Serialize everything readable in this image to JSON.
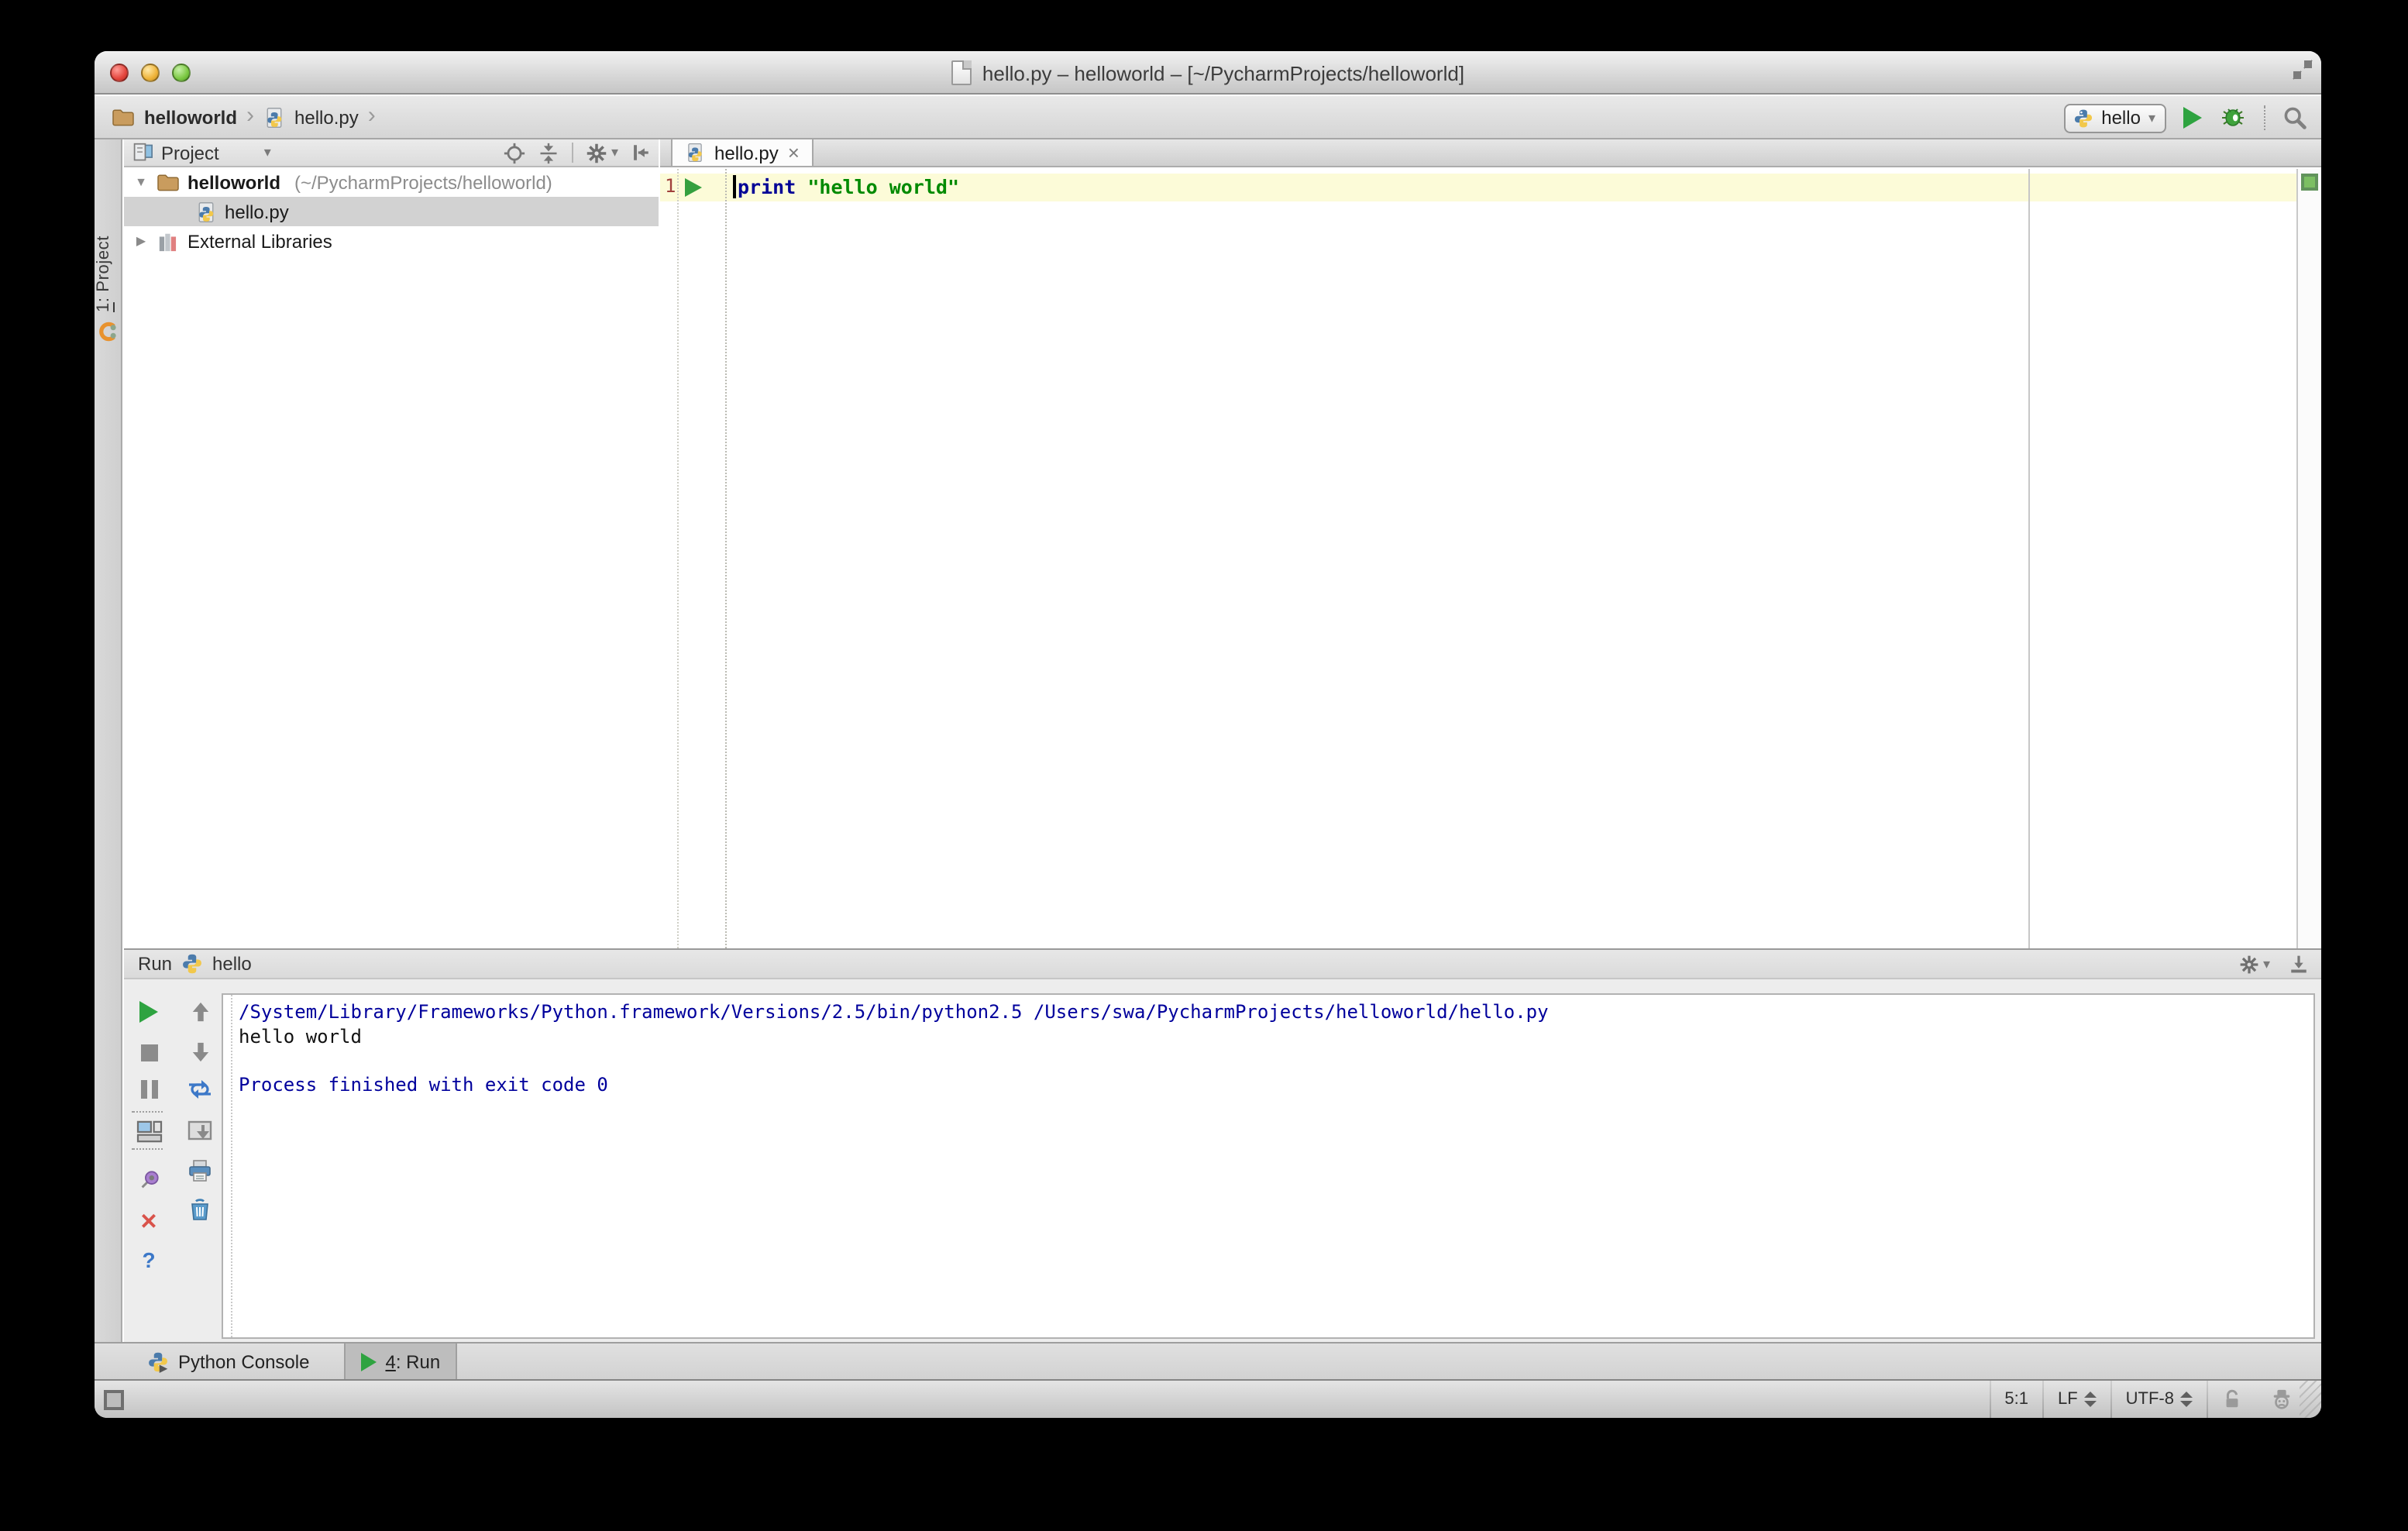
{
  "window": {
    "title": "hello.py – helloworld – [~/PycharmProjects/helloworld]"
  },
  "breadcrumbs": {
    "items": [
      {
        "label": "helloworld"
      },
      {
        "label": "hello.py"
      }
    ]
  },
  "nav_controls": {
    "run_config_name": "hello"
  },
  "left_stripe": {
    "num": "1",
    "rest": ": Project"
  },
  "project_panel": {
    "header": "Project",
    "tree": [
      {
        "name": "helloworld",
        "path": "(~/PycharmProjects/helloworld)"
      },
      {
        "name": "hello.py"
      },
      {
        "name": "External Libraries"
      }
    ]
  },
  "editor": {
    "tab_label": "hello.py",
    "tab_close": "×",
    "line_number": "1",
    "code_keyword": "print",
    "code_string": "\"hello world\""
  },
  "run_panel": {
    "title": "Run",
    "config_name": "hello",
    "help_glyph": "?",
    "close_glyph": "✕",
    "console_lines": [
      {
        "text": "/System/Library/Frameworks/Python.framework/Versions/2.5/bin/python2.5 /Users/swa/PycharmProjects/helloworld/hello.py",
        "kind": "system"
      },
      {
        "text": "hello world",
        "kind": "stdout"
      },
      {
        "text": "",
        "kind": "stdout"
      },
      {
        "text": "Process finished with exit code 0",
        "kind": "system"
      }
    ]
  },
  "toolwindow_bar": {
    "python_console_label": "Python Console",
    "run_tab_num": "4",
    "run_tab_rest": ": Run"
  },
  "status_bar": {
    "caret_position": "5:1",
    "line_separator": "LF",
    "encoding": "UTF-8"
  },
  "icons": {
    "tree_expanded": "▼",
    "tree_collapsed": "▶",
    "breadcrumb_chevron": "›",
    "dropdown_arrow": "▾"
  },
  "colors": {
    "keyword": "#000096",
    "string": "#008A00",
    "console_system": "#00009C",
    "caret_line_bg": "#FCFBD8",
    "run_green": "#2EA340",
    "error_red": "#D9534B",
    "inspect_ok_green": "#7CBF63"
  }
}
